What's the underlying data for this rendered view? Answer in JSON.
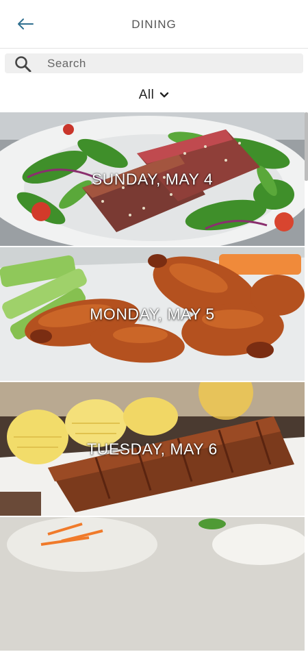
{
  "header": {
    "title": "DINING",
    "back_icon": "arrow-left-icon",
    "accent": "#2f6f8f"
  },
  "search": {
    "placeholder": "Search",
    "icon": "search-icon"
  },
  "filter": {
    "label": "All",
    "icon": "chevron-down-icon"
  },
  "days": [
    {
      "label": "SUNDAY, MAY 4"
    },
    {
      "label": "MONDAY, MAY 5"
    },
    {
      "label": "TUESDAY, MAY 6"
    },
    {
      "label": ""
    }
  ]
}
